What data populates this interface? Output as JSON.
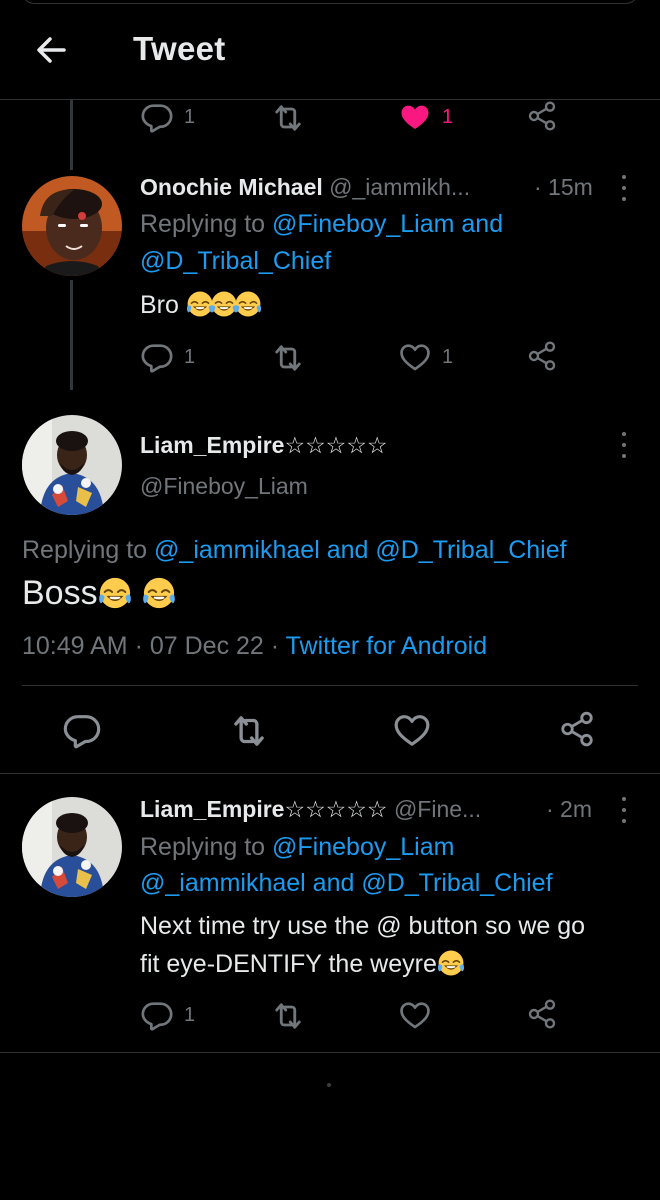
{
  "header": {
    "title": "Tweet"
  },
  "prev_tweet": {
    "reply_count": "1",
    "like_count": "1"
  },
  "reply1": {
    "name": "Onochie Michael",
    "handle": "@_iammikh...",
    "time": "· 15m",
    "replying_prefix": "Replying to",
    "mention1": "@Fineboy_Liam",
    "conj": "and",
    "mention2": "@D_Tribal_Chief",
    "text": "Bro",
    "emojis": [
      "joy",
      "joy",
      "joy"
    ],
    "reply_count": "1",
    "like_count": "1"
  },
  "main_tweet": {
    "name": "Liam_Empire☆☆☆☆☆",
    "handle": "@Fineboy_Liam",
    "replying_prefix": "Replying to",
    "mention1": "@_iammikhael",
    "conj": "and",
    "mention2": "@D_Tribal_Chief",
    "text": "Boss",
    "emojis": [
      "joy",
      "joy"
    ],
    "time": "10:49 AM",
    "sep1": "·",
    "date": "07 Dec 22",
    "sep2": "·",
    "source": "Twitter for Android"
  },
  "reply2": {
    "name": "Liam_Empire☆☆☆☆☆",
    "handle": "@Fine...",
    "time": "· 2m",
    "replying_prefix": "Replying to",
    "mention1": "@Fineboy_Liam",
    "mention2": "@_iammikhael",
    "conj": "and",
    "mention3": "@D_Tribal_Chief",
    "text_line1": "Next time try use the @ button so we go",
    "text_line2": "fit eye-DENTIFY the weyre",
    "emojis": [
      "joy"
    ],
    "reply_count": "1"
  },
  "icons": {
    "back": "arrow-left-icon",
    "reply": "speech-bubble-icon",
    "retweet": "retweet-icon",
    "like": "heart-icon",
    "share": "share-icon",
    "more": "vertical-dots-icon",
    "emoji": "face-with-tears-of-joy"
  },
  "colors": {
    "background": "#000000",
    "text": "#e7e9ea",
    "muted": "#71767b",
    "link": "#1d9bf0",
    "like_active": "#f91880",
    "divider": "#2f3336"
  }
}
